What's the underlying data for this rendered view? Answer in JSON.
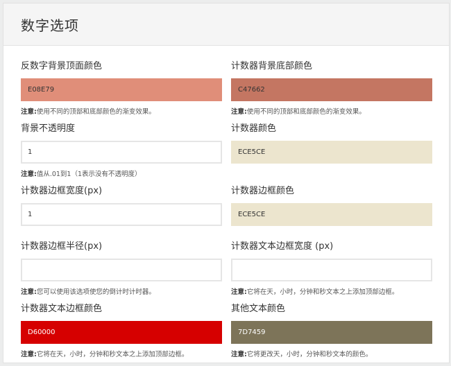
{
  "panel": {
    "title": "数字选项"
  },
  "note_prefix": "注意:",
  "fields": [
    {
      "label": "反数字背景顶面颜色",
      "value": "E08E79",
      "bg": "#e08e79",
      "text_color": "#333333",
      "note": "使用不同的顶部和底部颜色的渐变效果。"
    },
    {
      "label": "计数器背景底部颜色",
      "value": "C47662",
      "bg": "#c47662",
      "text_color": "#333333",
      "note": "使用不同的顶部和底部颜色的渐变效果。"
    },
    {
      "label": "背景不透明度",
      "value": "1",
      "bg": "#ffffff",
      "text_color": "#333333",
      "note": "值从.01到1（1表示没有不透明度）"
    },
    {
      "label": "计数器颜色",
      "value": "ECE5CE",
      "bg": "#ece5ce",
      "text_color": "#333333",
      "note": ""
    },
    {
      "label": "计数器边框宽度(px)",
      "value": "1",
      "bg": "#ffffff",
      "text_color": "#333333",
      "note": ""
    },
    {
      "label": "计数器边框颜色",
      "value": "ECE5CE",
      "bg": "#ece5ce",
      "text_color": "#333333",
      "note": ""
    },
    {
      "label": "计数器边框半径(px)",
      "value": "",
      "bg": "#ffffff",
      "text_color": "#333333",
      "note": "您可以使用该选项使您的倒计时计时器。"
    },
    {
      "label": "计数器文本边框宽度 (px)",
      "value": "",
      "bg": "#ffffff",
      "text_color": "#333333",
      "note": "它将在天，小时，分钟和秒文本之上添加顶部边框。"
    },
    {
      "label": "计数器文本边框颜色",
      "value": "D60000",
      "bg": "#d60000",
      "text_color": "#ffffff",
      "note": "它将在天，小时，分钟和秒文本之上添加顶部边框。"
    },
    {
      "label": "其他文本颜色",
      "value": "7D7459",
      "bg": "#7d7459",
      "text_color": "#ffffff",
      "note": "它将更改天，小时，分钟和秒文本的颜色。"
    }
  ]
}
